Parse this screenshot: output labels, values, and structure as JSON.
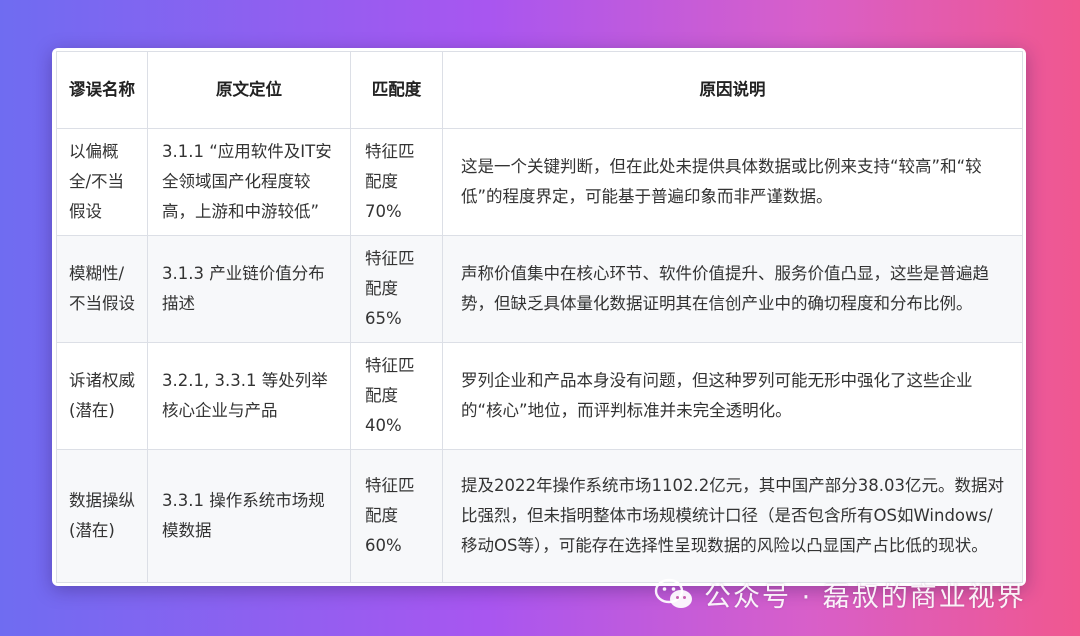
{
  "table": {
    "headers": [
      "谬误名称",
      "原文定位",
      "匹配度",
      "原因说明"
    ],
    "rows": [
      {
        "fallacy": "以偏概全/不当假设",
        "location": "3.1.1 “应用软件及IT安全领域国产化程度较高，上游和中游较低”",
        "match": "特征匹配度70%",
        "reason": "这是一个关键判断，但在此处未提供具体数据或比例来支持“较高”和“较低”的程度界定，可能基于普遍印象而非严谨数据。"
      },
      {
        "fallacy": "模糊性/不当假设",
        "location": "3.1.3 产业链价值分布描述",
        "match": "特征匹配度65%",
        "reason": "声称价值集中在核心环节、软件价值提升、服务价值凸显，这些是普遍趋势，但缺乏具体量化数据证明其在信创产业中的确切程度和分布比例。"
      },
      {
        "fallacy": "诉诸权威 (潜在)",
        "location": "3.2.1, 3.3.1 等处列举核心企业与产品",
        "match": "特征匹配度40%",
        "reason": "罗列企业和产品本身没有问题，但这种罗列可能无形中强化了这些企业的“核心”地位，而评判标准并未完全透明化。"
      },
      {
        "fallacy": "数据操纵 (潜在)",
        "location": "3.3.1 操作系统市场规模数据",
        "match": "特征匹配度60%",
        "reason": "提及2022年操作系统市场1102.2亿元，其中国产部分38.03亿元。数据对比强烈，但未指明整体市场规模统计口径（是否包含所有OS如Windows/移动OS等），可能存在选择性呈现数据的风险以凸显国产占比低的现状。"
      }
    ]
  },
  "watermark": {
    "text": "公众号 · 磊叔的商业视界",
    "icon": "wechat-icon"
  }
}
